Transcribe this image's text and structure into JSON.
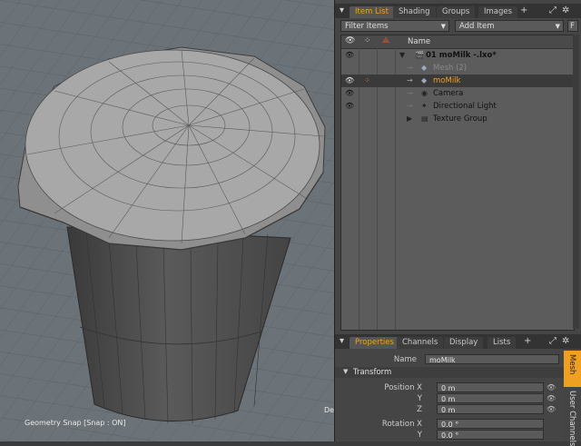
{
  "viewport": {
    "status": "Geometry Snap  [Snap : ON]",
    "del_label": "Del"
  },
  "item_list": {
    "tabs": [
      "Item List",
      "Shading",
      "Groups",
      "Images"
    ],
    "active_tab": "Item List",
    "filter_label": "Filter Items",
    "add_label": "Add Item",
    "f_label": "F",
    "name_header": "Name",
    "rows": [
      {
        "label": "01 moMilk -.lxo*",
        "icon": "scene-icon"
      },
      {
        "label": "Mesh (2)",
        "icon": "mesh-icon"
      },
      {
        "label": "moMilk",
        "icon": "mesh-icon",
        "selected": true
      },
      {
        "label": "Camera",
        "icon": "camera-icon"
      },
      {
        "label": "Directional Light",
        "icon": "light-icon"
      },
      {
        "label": "Texture Group",
        "icon": "texture-icon"
      }
    ]
  },
  "properties": {
    "tabs": [
      "Properties",
      "Channels",
      "Display",
      "Lists"
    ],
    "active_tab": "Properties",
    "name_label": "Name",
    "name_value": "moMilk",
    "section": "Transform",
    "position_label": "Position X",
    "y_label": "Y",
    "z_label": "Z",
    "px": "0 m",
    "py": "0 m",
    "pz": "0 m",
    "rotation_label": "Rotation X",
    "ry_label": "Y",
    "rx": "0.0 °",
    "ry": "0.0 °",
    "side_tabs": [
      "Mesh",
      "User Channels"
    ]
  },
  "colors": {
    "accent": "#f0a020",
    "selected_item": "#f0a020"
  }
}
